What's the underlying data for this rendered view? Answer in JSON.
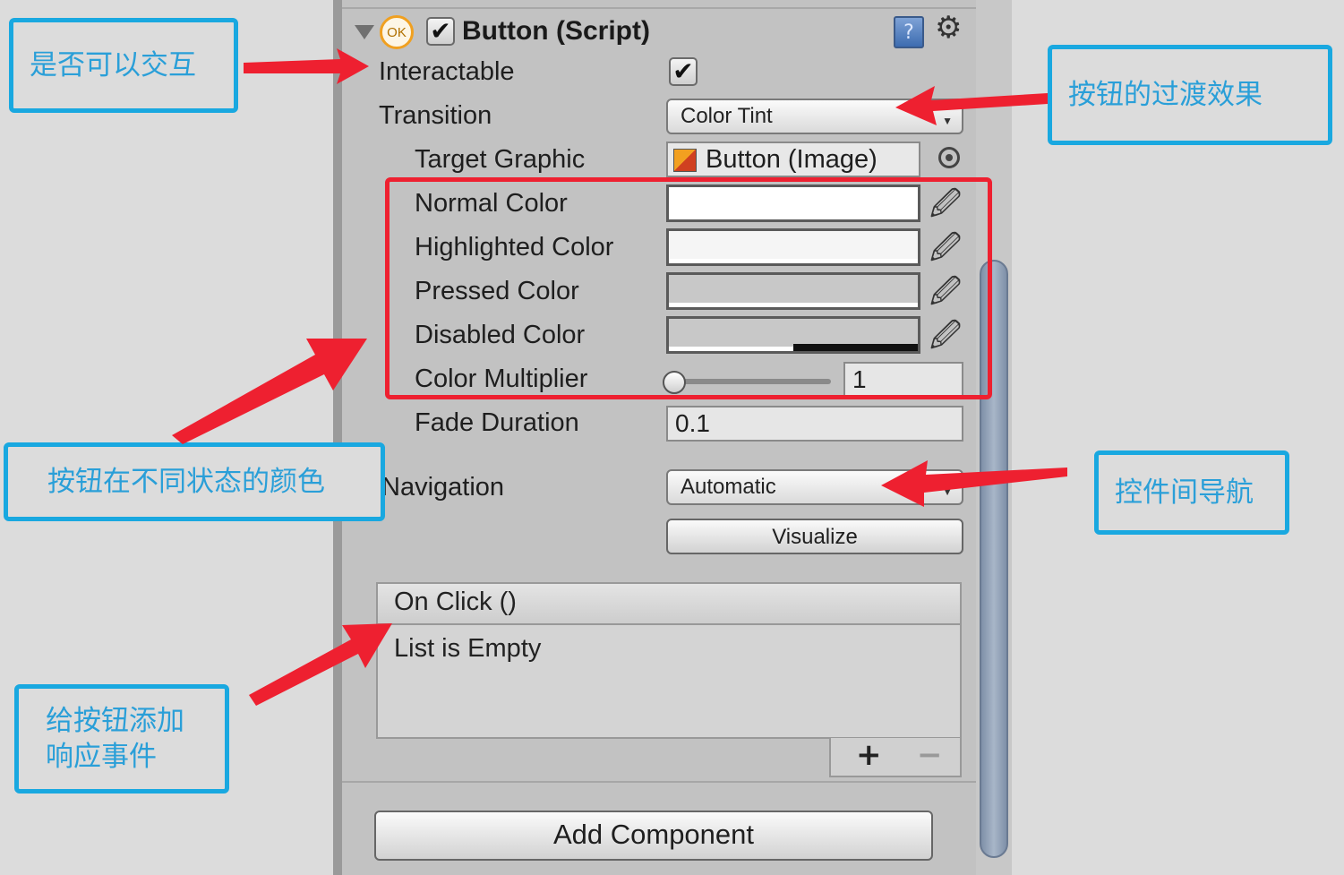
{
  "component": {
    "title": "Button (Script)",
    "ok_icon_text": "OK",
    "enabled": true
  },
  "fields": {
    "interactable_label": "Interactable",
    "interactable_checked": true,
    "transition_label": "Transition",
    "transition_value": "Color Tint",
    "target_graphic_label": "Target Graphic",
    "target_graphic_value": "Button (Image)",
    "normal_color_label": "Normal Color",
    "highlighted_color_label": "Highlighted Color",
    "pressed_color_label": "Pressed Color",
    "disabled_color_label": "Disabled Color",
    "color_multiplier_label": "Color Multiplier",
    "color_multiplier_value": "1",
    "color_multiplier_slider_fraction": 0.0,
    "fade_duration_label": "Fade Duration",
    "fade_duration_value": "0.1",
    "navigation_label": "Navigation",
    "navigation_value": "Automatic",
    "visualize_label": "Visualize"
  },
  "colors": {
    "normal": "#ffffff",
    "highlighted": "#f5f5f5",
    "pressed": "#c8c8c8",
    "disabled": "#c8c8c8",
    "annotation_blue": "#19a8e0",
    "annotation_red": "#ee2030"
  },
  "on_click": {
    "header": "On Click ()",
    "empty_text": "List is Empty",
    "add_symbol": "+",
    "remove_symbol": "−"
  },
  "add_component_label": "Add Component",
  "annotations": {
    "interactable": "是否可以交互",
    "transition": "按钮的过渡效果",
    "colors": "按钮在不同状态的颜色",
    "navigation": "控件间导航",
    "on_click": "给按钮添加响应事件"
  },
  "icons": [
    "fold-arrow-icon",
    "ok-icon",
    "book-help-icon",
    "gear-icon",
    "image-icon",
    "target-icon",
    "eyedropper-icon"
  ]
}
